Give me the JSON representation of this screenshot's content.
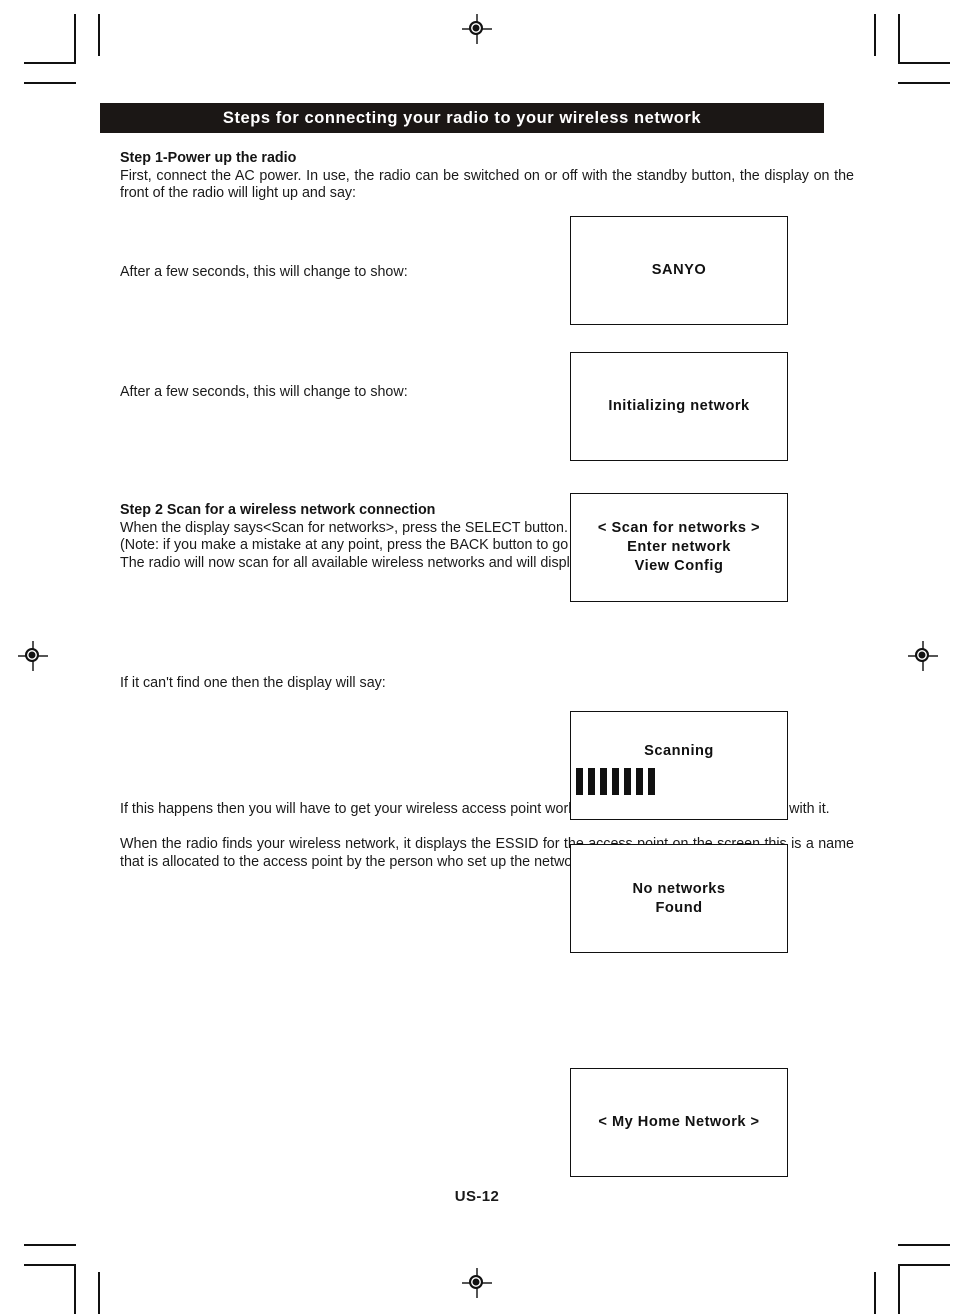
{
  "banner": {
    "title": "Steps for connecting your radio to your wireless network"
  },
  "step1": {
    "heading": "Step 1-Power up the radio",
    "body": "First, connect the AC power. In use, the radio can be switched on or off with the standby button, the display on the front of the radio will light up and say:",
    "after_1": "After a few seconds, this will change to show:",
    "after_2": "After a few seconds, this will change to show:"
  },
  "step2": {
    "heading": "Step 2  Scan for a wireless network connection",
    "line1": "When the display says<Scan for networks>, press the SELECT button.",
    "line2": "(Note: if you make a mistake at any point, press the BACK button to go back to the previous screen.)",
    "line3": "The radio will now scan for all available wireless networks and will display:",
    "cant_find": "If it can't find one then the display will say:",
    "if_happens": "If this happens then you will have to get your wireless access point working. See the instructions supplied with it.",
    "essid": "When the radio finds your wireless network, it displays the ESSID for the access point on the screen  this is a name that is allocated to the access point by the person who set up the network for example:"
  },
  "displays": {
    "brand": {
      "lines": [
        "SANYO"
      ]
    },
    "initializing": {
      "lines": [
        "Initializing network"
      ]
    },
    "menu": {
      "lines": [
        "< Scan for networks >",
        "Enter network",
        "View Config"
      ]
    },
    "scanning": {
      "lines": [
        "Scanning"
      ],
      "bar_count": 7
    },
    "no_networks": {
      "lines": [
        "No networks",
        "Found"
      ]
    },
    "essid_example": {
      "lines": [
        "< My Home Network >"
      ]
    }
  },
  "footer": {
    "page_number": "US-12"
  },
  "colors": {
    "banner_background": "#1b1715",
    "banner_text": "#ffffff",
    "ink": "#1a1a1a"
  }
}
